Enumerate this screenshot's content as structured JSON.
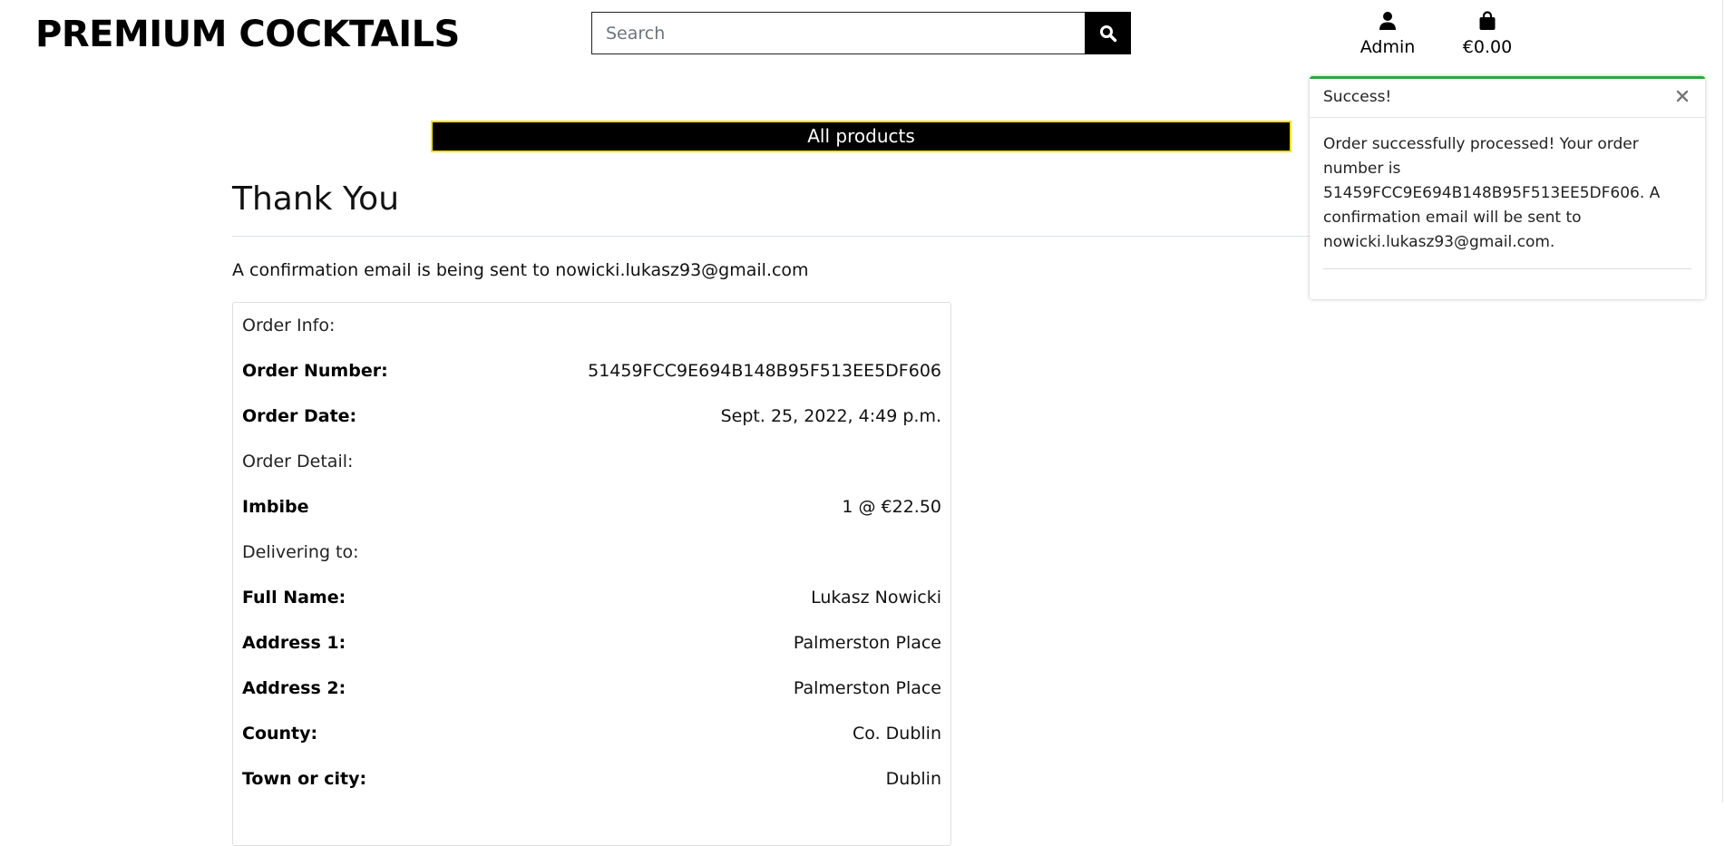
{
  "header": {
    "brand": "PREMIUM COCKTAILS",
    "search_placeholder": "Search",
    "search_icon": "search-icon",
    "account": {
      "label": "Admin",
      "icon": "user-icon"
    },
    "bag": {
      "total": "€0.00",
      "icon": "shopping-bag-icon"
    }
  },
  "nav": {
    "all_products": "All products",
    "bg_color": "#000000",
    "border_color": "#f5e000"
  },
  "main": {
    "title": "Thank You",
    "confirmation": "A confirmation email is being sent to nowicki.lukasz93@gmail.com"
  },
  "order": {
    "sections": {
      "info": "Order Info:",
      "detail": "Order Detail:",
      "delivery": "Delivering to:"
    },
    "number_label": "Order Number:",
    "number": "51459FCC9E694B148B95F513EE5DF606",
    "date_label": "Order Date:",
    "date": "Sept. 25, 2022, 4:49 p.m.",
    "item": {
      "name": "Imbibe",
      "qty_price": "1 @ €22.50"
    },
    "delivery": [
      {
        "label": "Full Name:",
        "value": "Lukasz Nowicki"
      },
      {
        "label": "Address 1:",
        "value": "Palmerston Place"
      },
      {
        "label": "Address 2:",
        "value": "Palmerston Place"
      },
      {
        "label": "County:",
        "value": "Co. Dublin"
      },
      {
        "label": "Town or city:",
        "value": "Dublin"
      }
    ]
  },
  "toast": {
    "title": "Success!",
    "message": "Order successfully processed! Your order number is 51459FCC9E694B148B95F513EE5DF606. A confirmation email will be sent to nowicki.lukasz93@gmail.com.",
    "close_icon": "close-icon",
    "accent_color": "#28a745"
  }
}
